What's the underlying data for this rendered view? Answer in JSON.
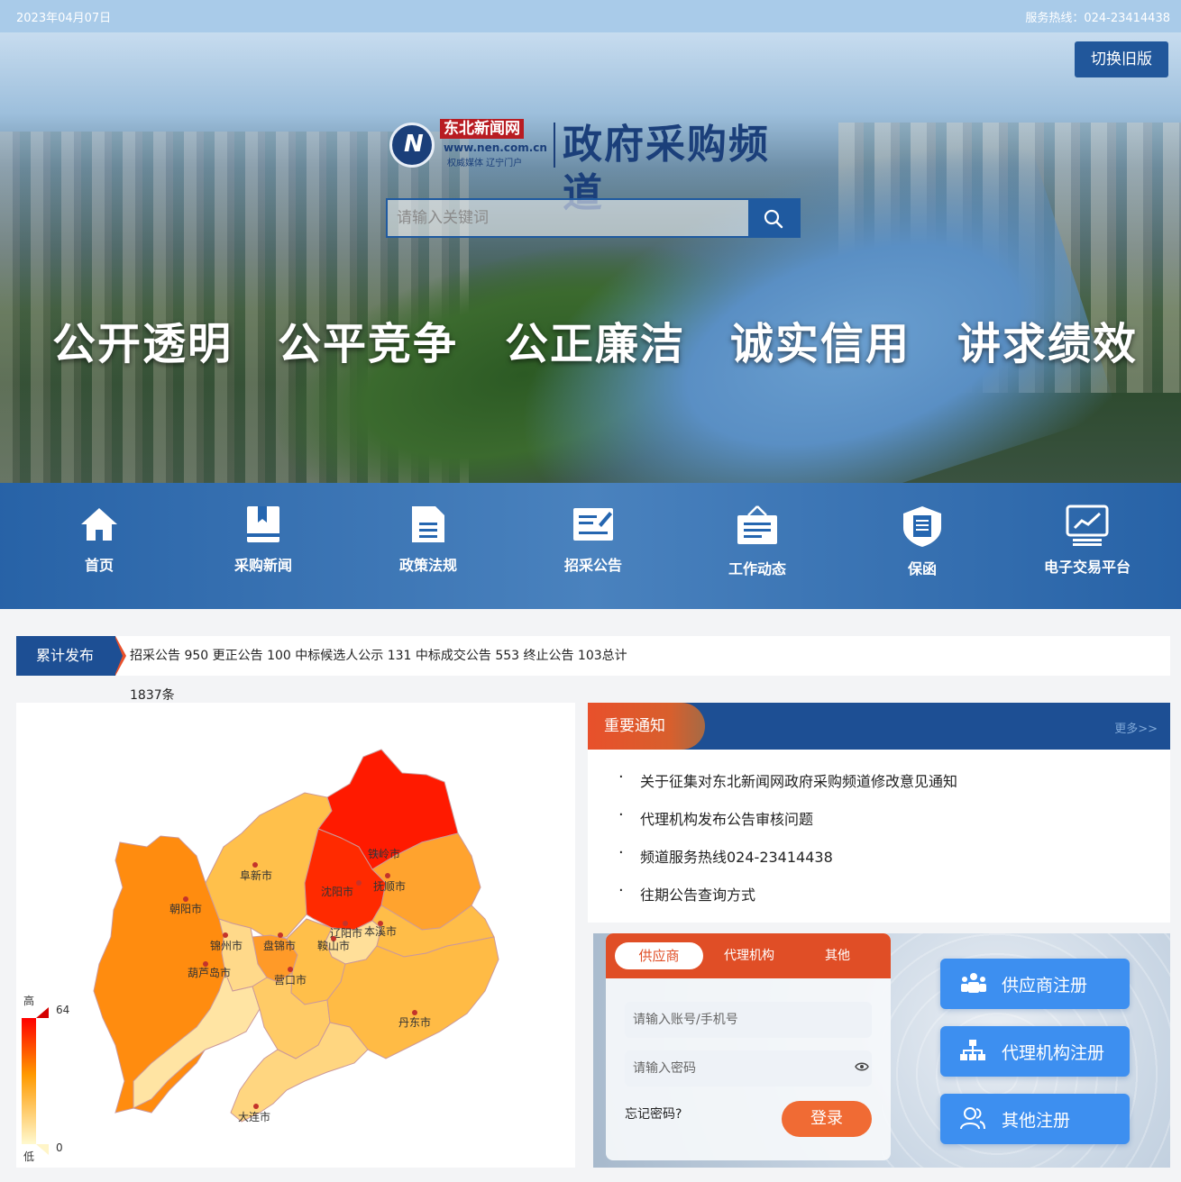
{
  "topbar": {
    "date": "2023年04月07日",
    "hotline": "服务热线：024-23414438"
  },
  "hero": {
    "switch_label": "切换旧版",
    "logo": {
      "cn": "东北新闻网",
      "url": "www.nen.com.cn",
      "slogan": "权威媒体 辽宁门户",
      "title": "政府采购频道"
    },
    "search_placeholder": "请输入关键词",
    "slogans": [
      "公开透明",
      "公平竞争",
      "公正廉洁",
      "诚实信用",
      "讲求绩效"
    ]
  },
  "nav": [
    {
      "label": "首页",
      "icon": "home-icon"
    },
    {
      "label": "采购新闻",
      "icon": "book-icon"
    },
    {
      "label": "政策法规",
      "icon": "document-icon"
    },
    {
      "label": "招采公告",
      "icon": "announcement-icon"
    },
    {
      "label": "工作动态",
      "icon": "signboard-icon"
    },
    {
      "label": "保函",
      "icon": "shield-icon"
    },
    {
      "label": "电子交易平台",
      "icon": "monitor-chart-icon"
    }
  ],
  "stats": {
    "tag": "累计发布",
    "text": "招采公告 950 更正公告 100 中标候选人公示 131 中标成交公告 553 终止公告 103总计 1837条"
  },
  "map": {
    "legend": {
      "high": "高",
      "low": "低",
      "max": "64",
      "min": "0"
    },
    "colors": {
      "high": "#ff0000",
      "mid": "#ff8a00",
      "low": "#fff8c8"
    },
    "cities": [
      {
        "name": "铁岭市",
        "level": "high"
      },
      {
        "name": "沈阳市",
        "level": "high"
      },
      {
        "name": "抚顺市",
        "level": "mid-high"
      },
      {
        "name": "阜新市",
        "level": "mid-low"
      },
      {
        "name": "朝阳市",
        "level": "mid"
      },
      {
        "name": "锦州市",
        "level": "low"
      },
      {
        "name": "盘锦市",
        "level": "mid"
      },
      {
        "name": "辽阳市",
        "level": "low"
      },
      {
        "name": "本溪市",
        "level": "mid-low"
      },
      {
        "name": "鞍山市",
        "level": "mid-low"
      },
      {
        "name": "葫芦岛市",
        "level": "low"
      },
      {
        "name": "营口市",
        "level": "mid-low"
      },
      {
        "name": "丹东市",
        "level": "mid-low"
      },
      {
        "name": "大连市",
        "level": "low"
      }
    ]
  },
  "notices": {
    "title": "重要通知",
    "more": "更多>>",
    "items": [
      "关于征集对东北新闻网政府采购频道修改意见通知",
      "代理机构发布公告审核问题",
      "频道服务热线024-23414438",
      "往期公告查询方式"
    ]
  },
  "login": {
    "tabs": [
      "供应商",
      "代理机构",
      "其他"
    ],
    "account_placeholder": "请输入账号/手机号",
    "password_placeholder": "请输入密码",
    "forgot": "忘记密码?",
    "submit": "登录"
  },
  "register": [
    "供应商注册",
    "代理机构注册",
    "其他注册"
  ]
}
